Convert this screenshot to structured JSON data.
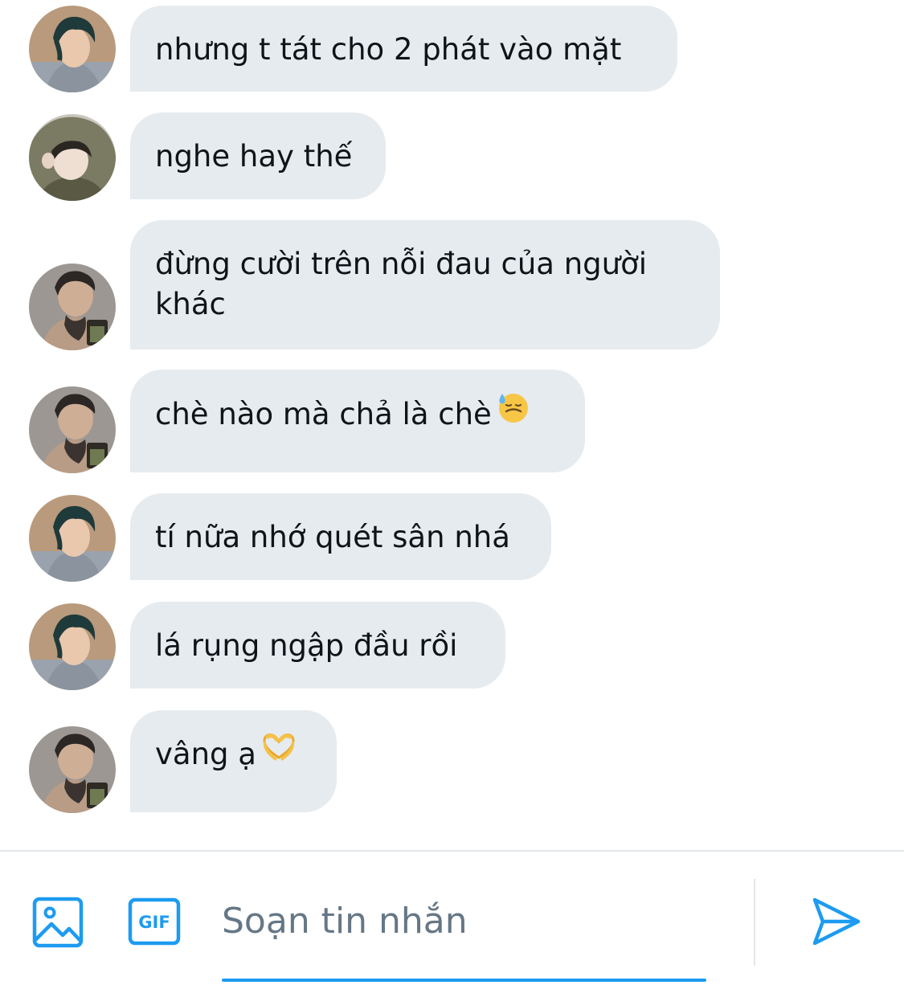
{
  "messages": [
    {
      "text": "nhưng t tát cho 2 phát vào mặt",
      "avatar": "avatar-green-hair"
    },
    {
      "text": "nghe hay thế",
      "avatar": "avatar-hooded-girl"
    },
    {
      "text": "đừng cười trên nỗi đau của người khác",
      "avatar": "avatar-tattoo-selfie"
    },
    {
      "text": "chè nào mà chả là chè",
      "emoji": "downcast-face-with-sweat-icon",
      "avatar": "avatar-tattoo-selfie"
    },
    {
      "text": "tí nữa nhớ quét sân nhá",
      "avatar": "avatar-green-hair"
    },
    {
      "text": "lá rụng ngập đầu rồi",
      "avatar": "avatar-green-hair"
    },
    {
      "text": "vâng ạ",
      "emoji": "heart-hands-icon",
      "avatar": "avatar-tattoo-selfie"
    }
  ],
  "composer": {
    "placeholder": "Soạn tin nhắn",
    "gif_label": "GIF",
    "icons": [
      "image-icon",
      "gif-icon",
      "send-icon"
    ]
  },
  "colors": {
    "bubble": "#e6ebef",
    "accent": "#1d9bf0",
    "placeholder": "#657786",
    "text": "#0f1419"
  }
}
